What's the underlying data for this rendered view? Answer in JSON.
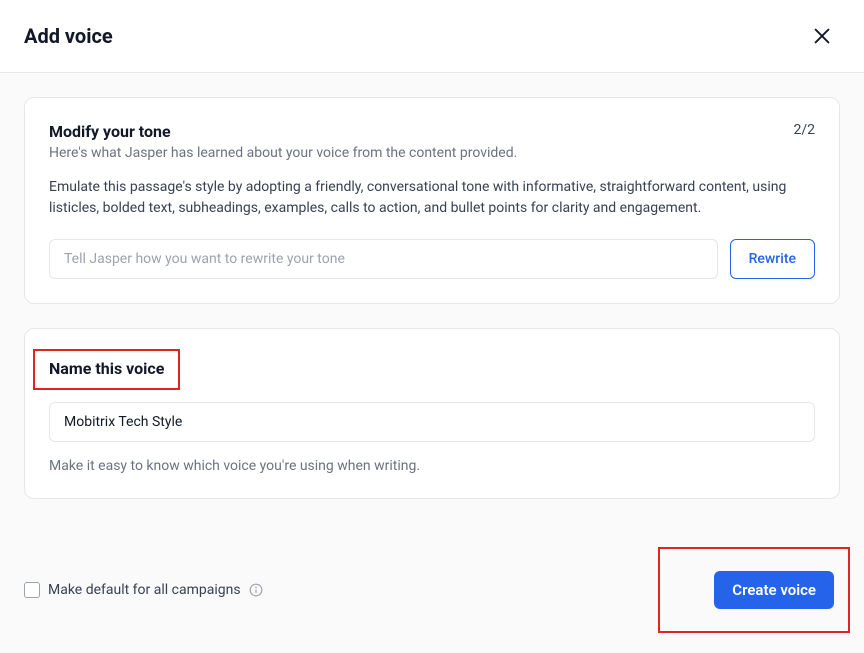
{
  "header": {
    "title": "Add voice"
  },
  "modify": {
    "title": "Modify your tone",
    "subtitle": "Here's what Jasper has learned about your voice from the content provided.",
    "description": "Emulate this passage's style by adopting a friendly, conversational tone with informative, straightforward content, using listicles, bolded text, subheadings, examples, calls to action, and bullet points for clarity and engagement.",
    "step": "2/2",
    "placeholder": "Tell Jasper how you want to rewrite your tone",
    "rewrite_label": "Rewrite"
  },
  "name": {
    "label": "Name this voice",
    "value": "Mobitrix Tech Style",
    "helper": "Make it easy to know which voice you're using when writing."
  },
  "footer": {
    "checkbox_label": "Make default for all campaigns",
    "create_label": "Create voice"
  }
}
